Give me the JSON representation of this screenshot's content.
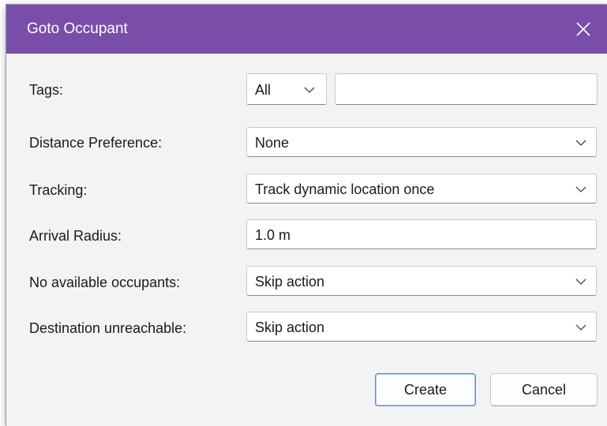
{
  "dialog": {
    "title": "Goto Occupant",
    "close_icon": "close-icon"
  },
  "colors": {
    "titlebar": "#7a4ea8",
    "dialog_bg": "#f3f3f3",
    "accent_border": "#5b8fd6"
  },
  "form": {
    "tags": {
      "label": "Tags:",
      "mode_value": "All",
      "text_value": ""
    },
    "distance_preference": {
      "label": "Distance Preference:",
      "value": "None"
    },
    "tracking": {
      "label": "Tracking:",
      "value": "Track dynamic location once"
    },
    "arrival_radius": {
      "label": "Arrival Radius:",
      "value": "1.0 m"
    },
    "no_available_occupants": {
      "label": "No available occupants:",
      "value": "Skip action"
    },
    "destination_unreachable": {
      "label": "Destination unreachable:",
      "value": "Skip action"
    }
  },
  "buttons": {
    "create": "Create",
    "cancel": "Cancel"
  }
}
